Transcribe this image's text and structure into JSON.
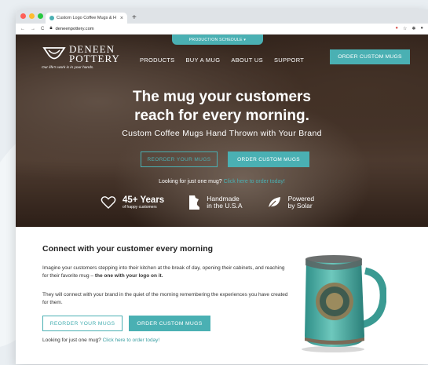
{
  "browser": {
    "tab_title": "Custom Logo Coffee Mugs & H",
    "tab_close": "×",
    "new_tab": "+",
    "url": "deneenpottery.com",
    "colors": {
      "red": "#ff5f57",
      "yellow": "#febc2e",
      "green": "#28c840"
    }
  },
  "header": {
    "production_schedule": "PRODUCTION SCHEDULE ▾",
    "logo_name_1": "DENEEN",
    "logo_name_2": "POTTERY",
    "logo_tagline": "Our life's work is in your hands.",
    "nav": [
      "PRODUCTS",
      "BUY A MUG",
      "ABOUT US",
      "SUPPORT"
    ],
    "order_button": "ORDER CUSTOM MUGS"
  },
  "hero": {
    "headline_1": "The mug your customers",
    "headline_2": "reach for every morning.",
    "subheadline": "Custom Coffee Mugs Hand Thrown with Your Brand",
    "reorder_button": "REORDER YOUR MUGS",
    "order_button": "ORDER CUSTOM MUGS",
    "just_one_prefix": "Looking for just one mug? ",
    "just_one_link": "Click here to order today!",
    "features": [
      {
        "big": "45+ Years",
        "small": "of happy customers"
      },
      {
        "line1": "Handmade",
        "line2": "in the U.S.A"
      },
      {
        "line1": "Powered",
        "line2": "by Solar"
      }
    ]
  },
  "main": {
    "heading": "Connect with your customer every morning",
    "para1_text": "Imagine your customers stepping into their kitchen at the break of day, opening their cabinets, and reaching for their favorite mug – ",
    "para1_bold": "the one with your logo on it.",
    "para2": "They will connect with your brand in the quiet of the morning remembering the experiences you have created for them.",
    "reorder_button": "REORDER YOUR MUGS",
    "order_button": "ORDER CUSTOM MUGS",
    "just_one_prefix": "Looking for just one mug? ",
    "just_one_link": "Click here to order today!"
  },
  "colors": {
    "accent": "#4ab0b3"
  }
}
